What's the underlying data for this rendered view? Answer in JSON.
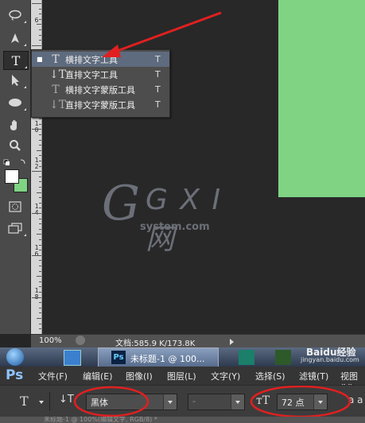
{
  "toolbar": {
    "tools": [
      "lasso-icon",
      "pen-icon",
      "type-icon",
      "path-selection-icon",
      "ellipse-icon",
      "hand-icon",
      "zoom-icon",
      "color-swatch-icon",
      "quick-mask-icon",
      "screen-mode-icon"
    ]
  },
  "ruler": {
    "numbers": [
      "6",
      "1\n0",
      "1\n2",
      "1\n4",
      "1\n6",
      "1\n8"
    ]
  },
  "flyout": {
    "items": [
      {
        "label": "横排文字工具",
        "key": "T",
        "selected": true
      },
      {
        "label": "直排文字工具",
        "key": "T",
        "selected": false
      },
      {
        "label": "横排文字蒙版工具",
        "key": "T",
        "selected": false
      },
      {
        "label": "直排文字蒙版工具",
        "key": "T",
        "selected": false
      }
    ]
  },
  "watermark": {
    "logo": "G X I 网",
    "site": "system.com"
  },
  "status": {
    "zoom": "100%",
    "doc_info": "文档:585.9 K/173.8K"
  },
  "taskbar": {
    "ps_task_label": "未标题-1 @ 100...",
    "baidu_text": "Baidu经验",
    "baidu_url": "jingyan.baidu.com"
  },
  "menubar": {
    "logo": "Ps",
    "items": [
      "文件(F)",
      "编辑(E)",
      "图像(I)",
      "图层(L)",
      "文字(Y)",
      "选择(S)",
      "滤镜(T)",
      "视图(V)"
    ]
  },
  "options": {
    "tool_letter": "T",
    "font_family": "黑体",
    "font_style": "-",
    "font_size": "72 点",
    "aa_label": "a a"
  },
  "bottom_tab": {
    "text": "未标题-1 @ 100%(编辑文字, RGB/8) *"
  },
  "colors": {
    "accent_red": "#e02020",
    "canvas_green": "#7fd383"
  }
}
